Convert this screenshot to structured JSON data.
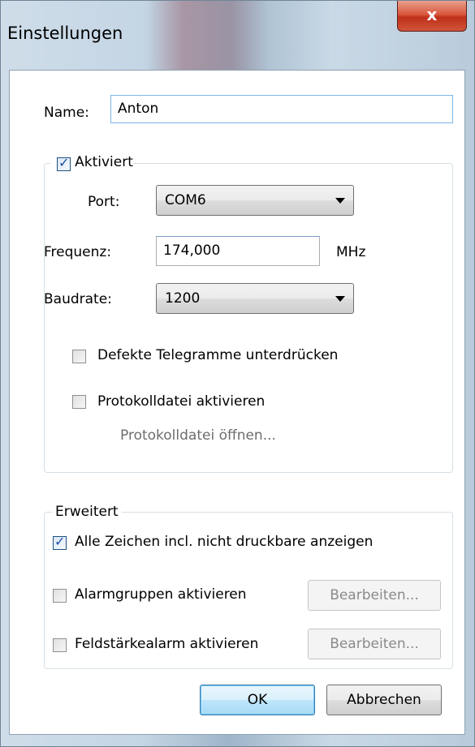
{
  "window": {
    "title": "Einstellungen",
    "close_glyph": "x"
  },
  "name_field": {
    "label": "Name:",
    "value": "Anton"
  },
  "activated_group": {
    "checkbox_label": "Aktiviert",
    "checked": true,
    "port": {
      "label": "Port:",
      "value": "COM6"
    },
    "frequency": {
      "label": "Frequenz:",
      "value": "174,000",
      "unit": "MHz"
    },
    "baudrate": {
      "label": "Baudrate:",
      "value": "1200"
    },
    "suppress_defective": {
      "label": "Defekte Telegramme unterdrücken",
      "checked": false
    },
    "log_file": {
      "label": "Protokolldatei aktivieren",
      "checked": false
    },
    "open_log_link": "Protokolldatei öffnen..."
  },
  "advanced_group": {
    "legend": "Erweitert",
    "show_all_chars": {
      "label": "Alle Zeichen incl. nicht druckbare anzeigen",
      "checked": true
    },
    "alarm_groups": {
      "label": "Alarmgruppen aktivieren",
      "checked": false,
      "button": "Bearbeiten..."
    },
    "field_strength": {
      "label": "Feldstärkealarm aktivieren",
      "checked": false,
      "button": "Bearbeiten..."
    }
  },
  "buttons": {
    "ok": "OK",
    "cancel": "Abbrechen"
  },
  "colors": {
    "accent": "#3c7fb1",
    "close_button": "#c0301a",
    "frame": "#c4d5e4"
  }
}
